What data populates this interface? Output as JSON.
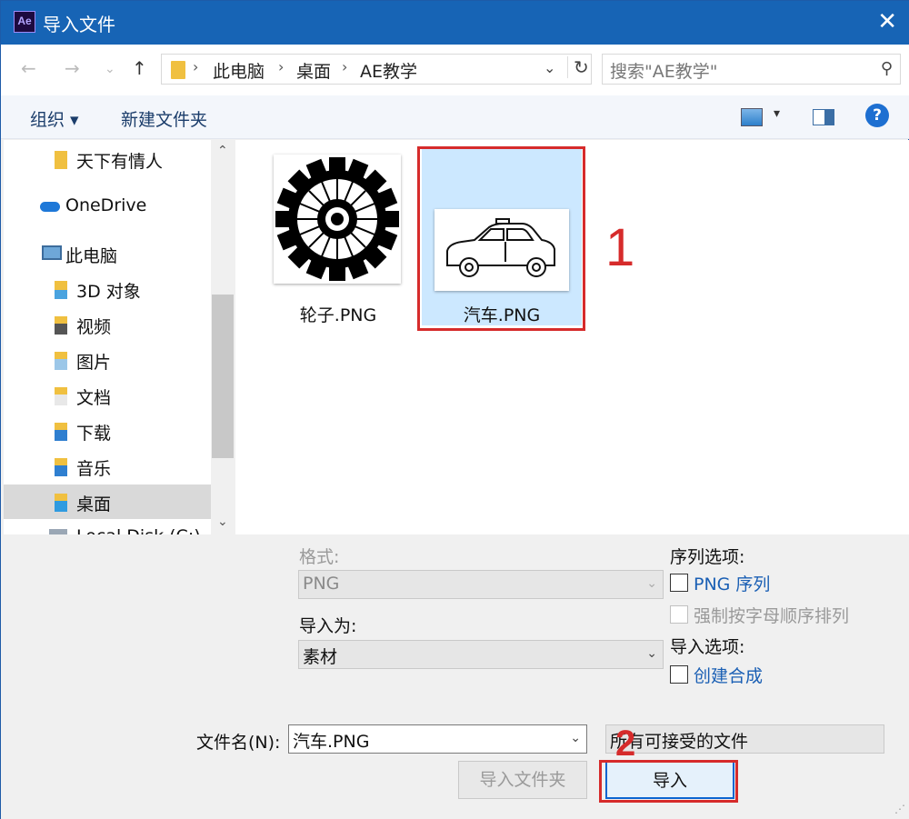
{
  "window": {
    "app_icon_text": "Ae",
    "title": "导入文件"
  },
  "address_bar": {
    "crumbs": [
      "此电脑",
      "桌面",
      "AE教学"
    ],
    "search_placeholder": "搜索\"AE教学\""
  },
  "toolbar": {
    "organize": "组织 ▾",
    "new_folder": "新建文件夹",
    "help": "?"
  },
  "nav_pane": {
    "items": [
      {
        "label": "天下有情人",
        "icon": "folder-icon"
      },
      {
        "label": "OneDrive",
        "icon": "onedrive-icon"
      },
      {
        "label": "此电脑",
        "icon": "computer-icon"
      },
      {
        "label": "3D 对象",
        "icon": "3d-objects-folder-icon"
      },
      {
        "label": "视频",
        "icon": "videos-folder-icon"
      },
      {
        "label": "图片",
        "icon": "pictures-folder-icon"
      },
      {
        "label": "文档",
        "icon": "documents-folder-icon"
      },
      {
        "label": "下载",
        "icon": "downloads-folder-icon"
      },
      {
        "label": "音乐",
        "icon": "music-folder-icon"
      },
      {
        "label": "桌面",
        "icon": "desktop-folder-icon",
        "selected": true
      },
      {
        "label": "Local Disk (C:)",
        "icon": "disk-icon"
      }
    ]
  },
  "files": [
    {
      "name": "轮子.PNG",
      "thumbnail": "gear-wheel-image"
    },
    {
      "name": "汽车.PNG",
      "thumbnail": "car-image",
      "selected": true
    }
  ],
  "annotations": {
    "step1": "1",
    "step2": "2"
  },
  "options": {
    "format_label": "格式:",
    "format_value": "PNG",
    "import_as_label": "导入为:",
    "import_as_value": "素材",
    "sequence_options_label": "序列选项:",
    "png_sequence": "PNG 序列",
    "force_alpha": "强制按字母顺序排列",
    "import_options_label": "导入选项:",
    "create_composition": "创建合成"
  },
  "footer": {
    "filename_label": "文件名(N):",
    "filename_value": "汽车.PNG",
    "filetype_value": "所有可接受的文件",
    "import_folder_button": "导入文件夹",
    "import_button": "导入"
  },
  "colors": {
    "titlebar": "#1764b5",
    "annotation_red": "#d62b2b",
    "selection_blue": "#cce8ff",
    "link_blue": "#1a5fb4"
  }
}
